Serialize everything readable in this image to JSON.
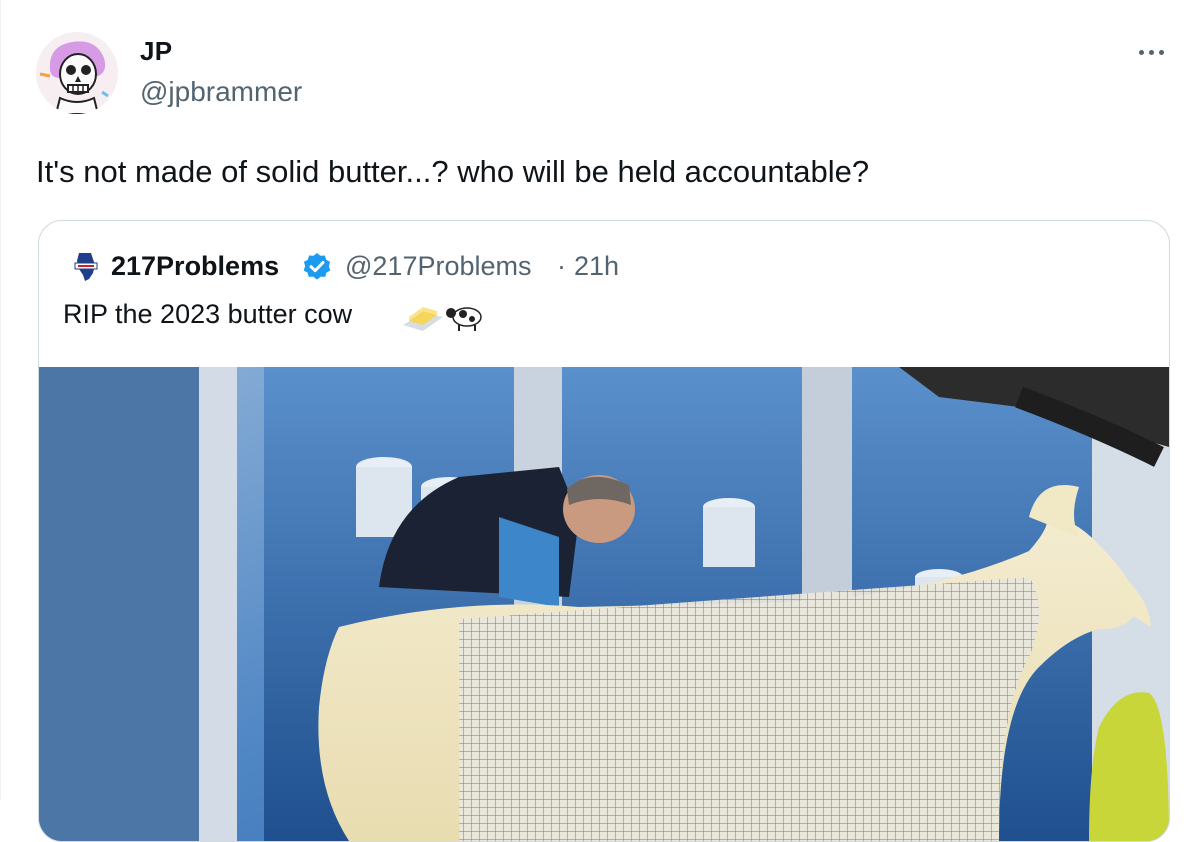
{
  "tweet": {
    "author_name": "JP",
    "author_handle": "@jpbrammer",
    "avatar_icon": "skeleton-avatar-icon",
    "more_icon": "more-horizontal-icon",
    "text": "It's not made of solid butter...? who will be held accountable?"
  },
  "quote": {
    "author_name": "217Problems",
    "author_handle": "@217Problems",
    "separator": "·",
    "time": "21h",
    "verified_icon": "verified-badge-icon",
    "avatar_icon": "illinois-state-icon",
    "text": "RIP the 2023 butter cow",
    "emoji_icons": [
      "butter-icon",
      "cow-icon"
    ],
    "media_icon": "butter-cow-sculpture-photo"
  },
  "colors": {
    "text_primary": "#0f1419",
    "text_secondary": "#536471",
    "border": "#cfd9de",
    "verified_blue": "#1d9bf0"
  }
}
